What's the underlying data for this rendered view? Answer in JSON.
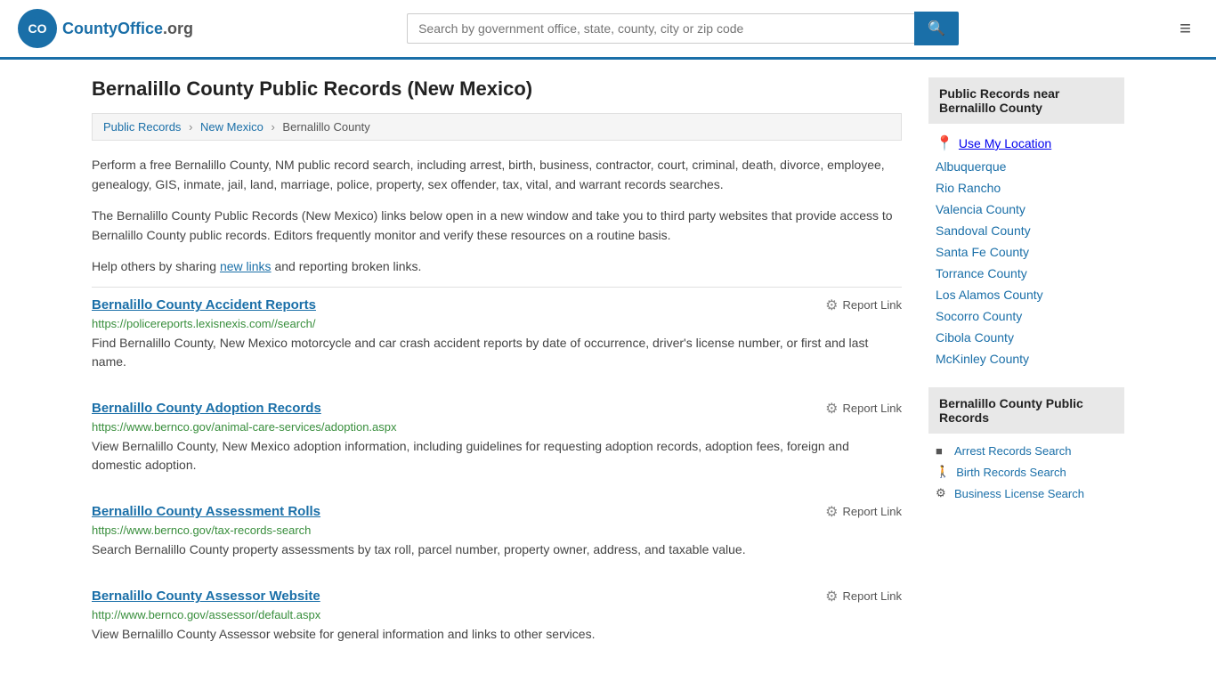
{
  "header": {
    "logo_text": "CountyOffice",
    "logo_suffix": ".org",
    "search_placeholder": "Search by government office, state, county, city or zip code",
    "search_btn_icon": "🔍",
    "menu_icon": "≡"
  },
  "page": {
    "title": "Bernalillo County Public Records (New Mexico)",
    "breadcrumb": {
      "items": [
        "Public Records",
        "New Mexico",
        "Bernalillo County"
      ]
    },
    "desc1": "Perform a free Bernalillo County, NM public record search, including arrest, birth, business, contractor, court, criminal, death, divorce, employee, genealogy, GIS, inmate, jail, land, marriage, police, property, sex offender, tax, vital, and warrant records searches.",
    "desc2": "The Bernalillo County Public Records (New Mexico) links below open in a new window and take you to third party websites that provide access to Bernalillo County public records. Editors frequently monitor and verify these resources on a routine basis.",
    "desc3_prefix": "Help others by sharing ",
    "desc3_link": "new links",
    "desc3_suffix": " and reporting broken links.",
    "records": [
      {
        "title": "Bernalillo County Accident Reports",
        "url": "https://policereports.lexisnexis.com//search/",
        "desc": "Find Bernalillo County, New Mexico motorcycle and car crash accident reports by date of occurrence, driver's license number, or first and last name.",
        "report_label": "Report Link"
      },
      {
        "title": "Bernalillo County Adoption Records",
        "url": "https://www.bernco.gov/animal-care-services/adoption.aspx",
        "desc": "View Bernalillo County, New Mexico adoption information, including guidelines for requesting adoption records, adoption fees, foreign and domestic adoption.",
        "report_label": "Report Link"
      },
      {
        "title": "Bernalillo County Assessment Rolls",
        "url": "https://www.bernco.gov/tax-records-search",
        "desc": "Search Bernalillo County property assessments by tax roll, parcel number, property owner, address, and taxable value.",
        "report_label": "Report Link"
      },
      {
        "title": "Bernalillo County Assessor Website",
        "url": "http://www.bernco.gov/assessor/default.aspx",
        "desc": "View Bernalillo County Assessor website for general information and links to other services.",
        "report_label": "Report Link"
      }
    ]
  },
  "sidebar": {
    "nearby_title": "Public Records near Bernalillo County",
    "use_my_location": "Use My Location",
    "nearby_links": [
      "Albuquerque",
      "Rio Rancho",
      "Valencia County",
      "Sandoval County",
      "Santa Fe County",
      "Torrance County",
      "Los Alamos County",
      "Socorro County",
      "Cibola County",
      "McKinley County"
    ],
    "records_title": "Bernalillo County Public Records",
    "records_links": [
      {
        "label": "Arrest Records Search",
        "icon": "■"
      },
      {
        "label": "Birth Records Search",
        "icon": "🚶"
      },
      {
        "label": "Business License Search",
        "icon": "⚙"
      }
    ]
  }
}
